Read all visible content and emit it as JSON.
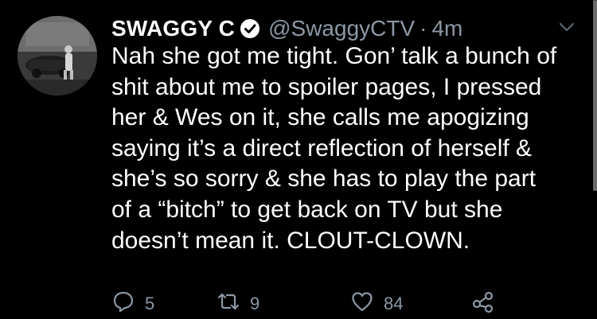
{
  "tweet": {
    "display_name": "SWAGGY C",
    "handle": "@SwaggyCTV",
    "separator": "·",
    "time": "4m",
    "text": "Nah she got me tight. Gon’ talk a bunch of\nshit about me to spoiler pages, I pressed\nher & Wes on it, she calls me apogizing\nsaying it’s a direct reflection of herself &\nshe’s so sorry & she has to play the part\nof a “bitch” to get back on TV but she\ndoesn’t mean it. CLOUT-CLOWN.",
    "verified": true
  },
  "actions": {
    "reply_count": "5",
    "retweet_count": "9",
    "like_count": "84"
  },
  "icons": {
    "reply": "reply-icon",
    "retweet": "retweet-icon",
    "like": "heart-icon",
    "share": "share-icon",
    "verified": "verified-badge-icon",
    "more": "chevron-down-icon"
  },
  "colors": {
    "background": "#000000",
    "text": "#ffffff",
    "secondary": "#8b98a5"
  }
}
